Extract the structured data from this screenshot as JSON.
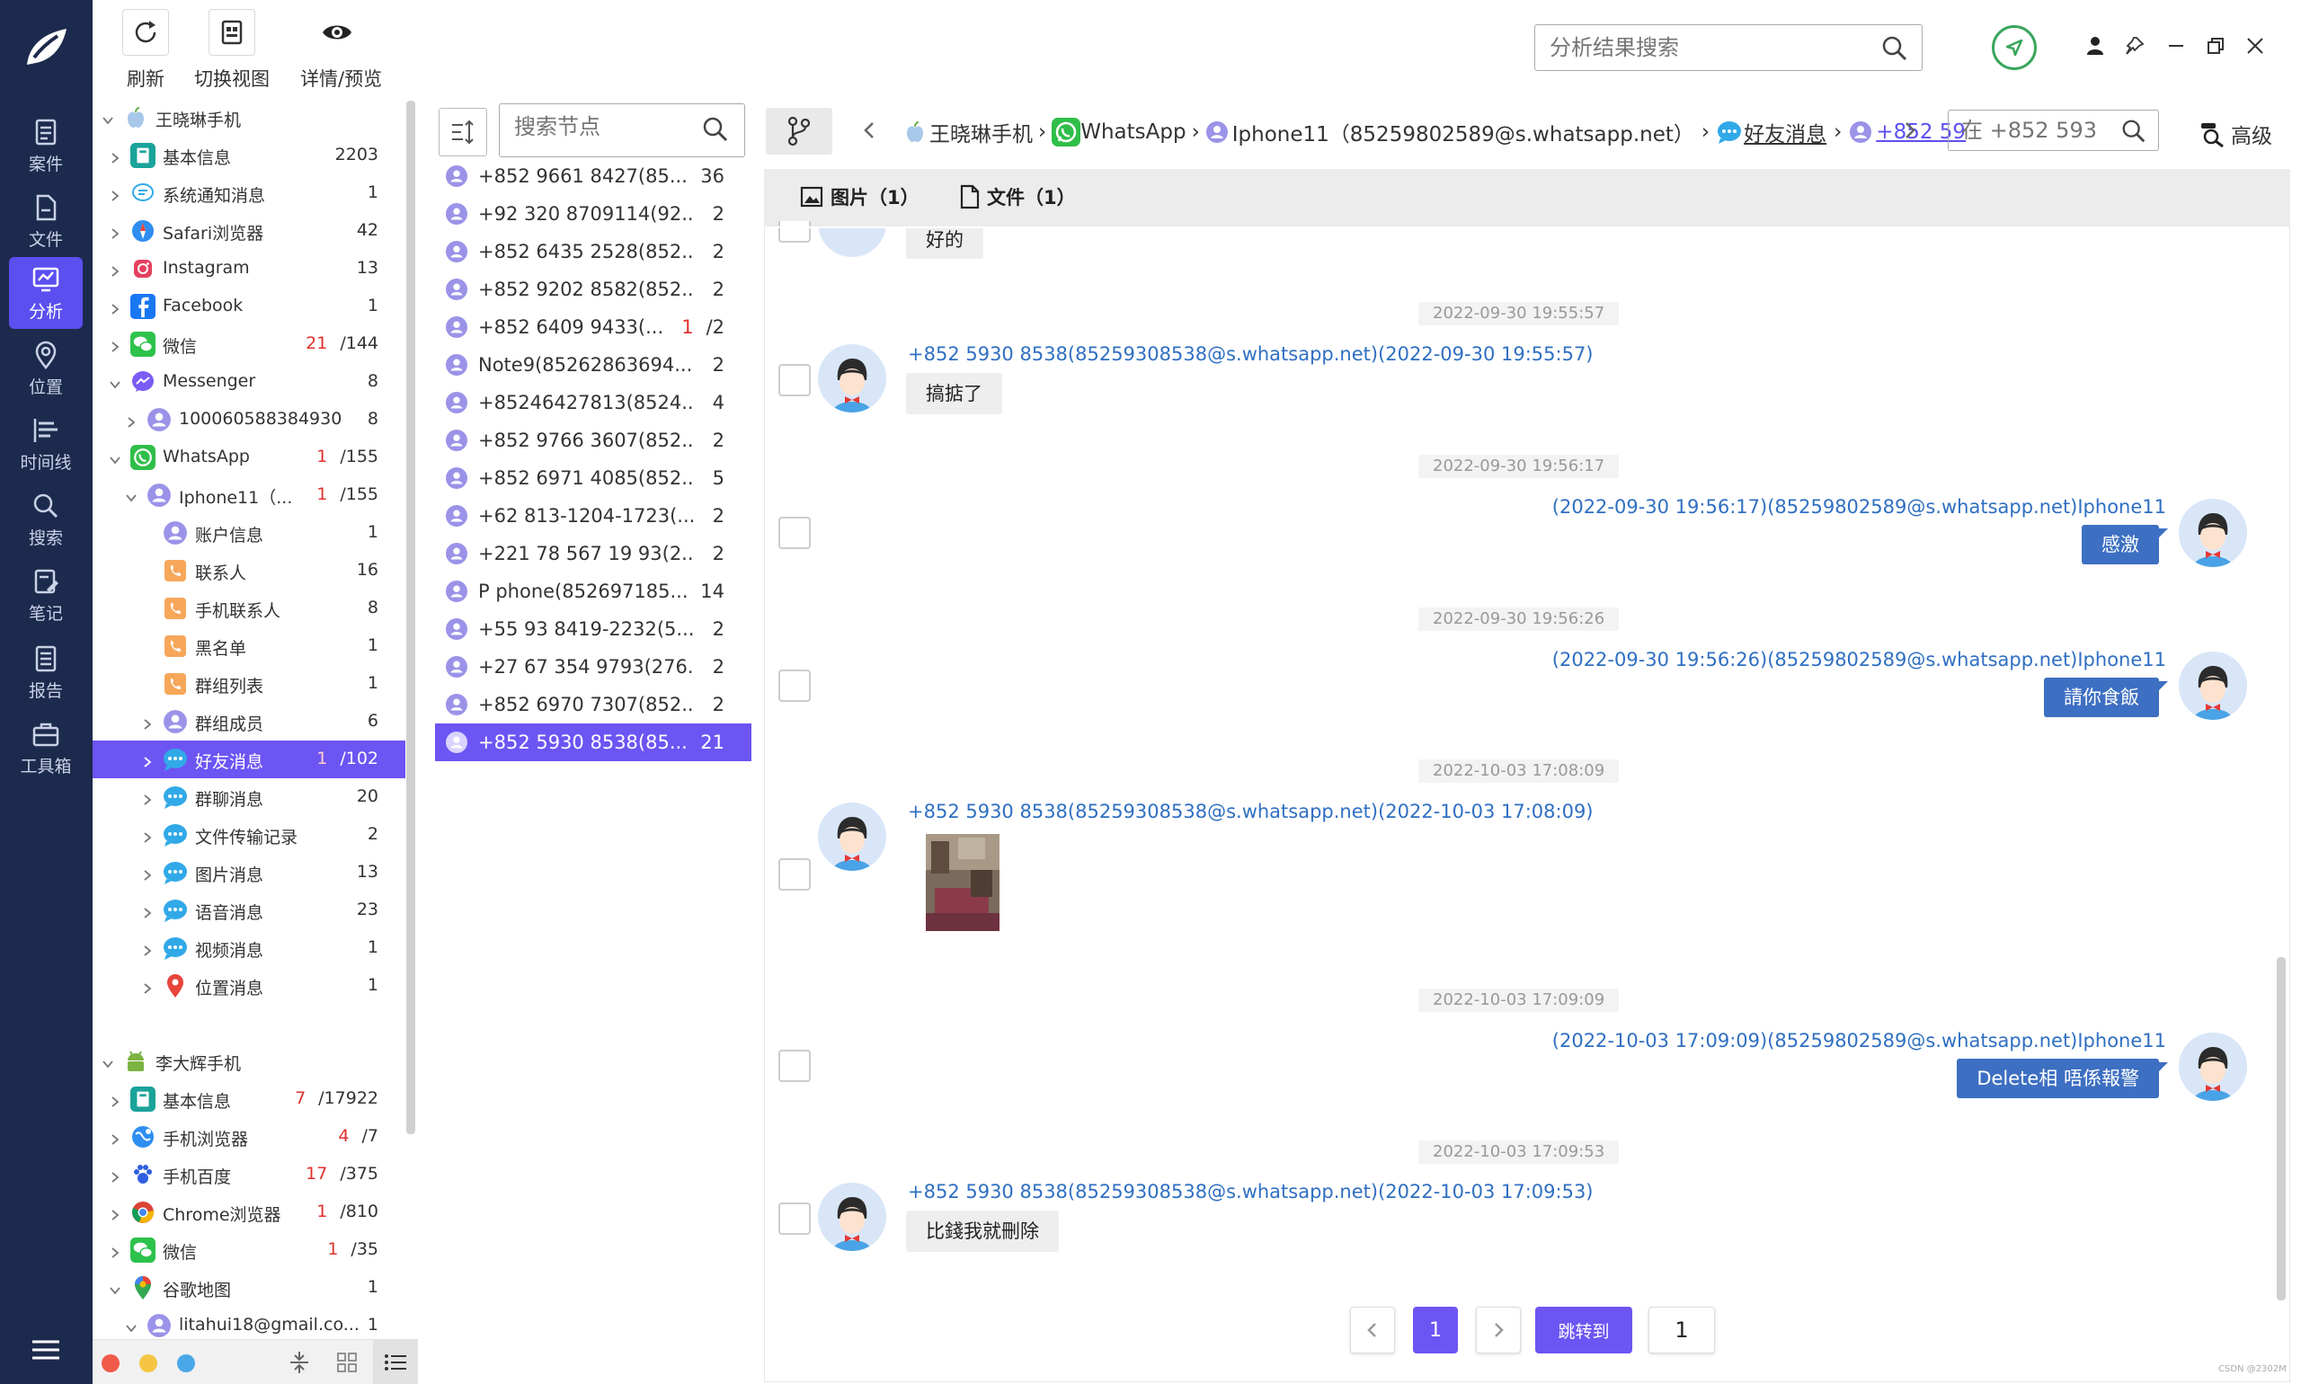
{
  "toolbar": {
    "refresh": "刷新",
    "switch_view": "切换视图",
    "detail_preview": "详情/预览",
    "search_placeholder": "分析结果搜索"
  },
  "nav": {
    "items": [
      {
        "label": "案件"
      },
      {
        "label": "文件"
      },
      {
        "label": "分析"
      },
      {
        "label": "位置"
      },
      {
        "label": "时间线"
      },
      {
        "label": "搜索"
      },
      {
        "label": "笔记"
      },
      {
        "label": "报告"
      },
      {
        "label": "工具箱"
      }
    ]
  },
  "tree": {
    "rows": [
      {
        "label": "王晓琳手机",
        "count": "",
        "red": ""
      },
      {
        "label": "基本信息",
        "count": "2203",
        "red": ""
      },
      {
        "label": "系统通知消息",
        "count": "1",
        "red": ""
      },
      {
        "label": "Safari浏览器",
        "count": "42",
        "red": ""
      },
      {
        "label": "Instagram",
        "count": "13",
        "red": ""
      },
      {
        "label": "Facebook",
        "count": "1",
        "red": ""
      },
      {
        "label": "微信",
        "count": "/144",
        "red": "21"
      },
      {
        "label": "Messenger",
        "count": "8",
        "red": ""
      },
      {
        "label": "100060588384930",
        "count": "8",
        "red": ""
      },
      {
        "label": "WhatsApp",
        "count": "/155",
        "red": "1"
      },
      {
        "label": "Iphone11（...",
        "count": "/155",
        "red": "1"
      },
      {
        "label": "账户信息",
        "count": "1",
        "red": ""
      },
      {
        "label": "联系人",
        "count": "16",
        "red": ""
      },
      {
        "label": "手机联系人",
        "count": "8",
        "red": ""
      },
      {
        "label": "黑名单",
        "count": "1",
        "red": ""
      },
      {
        "label": "群组列表",
        "count": "1",
        "red": ""
      },
      {
        "label": "群组成员",
        "count": "6",
        "red": ""
      },
      {
        "label": "好友消息",
        "count": "/102",
        "red": "1"
      },
      {
        "label": "群聊消息",
        "count": "20",
        "red": ""
      },
      {
        "label": "文件传输记录",
        "count": "2",
        "red": ""
      },
      {
        "label": "图片消息",
        "count": "13",
        "red": ""
      },
      {
        "label": "语音消息",
        "count": "23",
        "red": ""
      },
      {
        "label": "视频消息",
        "count": "1",
        "red": ""
      },
      {
        "label": "位置消息",
        "count": "1",
        "red": ""
      },
      {
        "label": "李大辉手机",
        "count": "",
        "red": ""
      },
      {
        "label": "基本信息",
        "count": "/17922",
        "red": "7"
      },
      {
        "label": "手机浏览器",
        "count": "/7",
        "red": "4"
      },
      {
        "label": "手机百度",
        "count": "/375",
        "red": "17"
      },
      {
        "label": "Chrome浏览器",
        "count": "/810",
        "red": "1"
      },
      {
        "label": "微信",
        "count": "/35",
        "red": "1"
      },
      {
        "label": "谷歌地图",
        "count": "1",
        "red": ""
      },
      {
        "label": "litahui18@gmail.co...",
        "count": "1",
        "red": ""
      }
    ]
  },
  "contacts": {
    "search_placeholder": "搜索节点",
    "items": [
      {
        "name": "+852 9661 8427(85...",
        "count": "36",
        "red": ""
      },
      {
        "name": "+92 320 8709114(92...",
        "count": "2",
        "red": ""
      },
      {
        "name": "+852 6435 2528(852...",
        "count": "2",
        "red": ""
      },
      {
        "name": "+852 9202 8582(852...",
        "count": "2",
        "red": ""
      },
      {
        "name": "+852 6409 9433(...",
        "count": "/2",
        "red": "1"
      },
      {
        "name": "Note9(85262863694...",
        "count": "2",
        "red": ""
      },
      {
        "name": "+85246427813(8524...",
        "count": "4",
        "red": ""
      },
      {
        "name": "+852 9766 3607(852...",
        "count": "2",
        "red": ""
      },
      {
        "name": "+852 6971 4085(852...",
        "count": "5",
        "red": ""
      },
      {
        "name": "+62 813-1204-1723(...",
        "count": "2",
        "red": ""
      },
      {
        "name": "+221 78 567 19 93(2...",
        "count": "2",
        "red": ""
      },
      {
        "name": "P phone(852697185...",
        "count": "14",
        "red": ""
      },
      {
        "name": "+55 93 8419-2232(5...",
        "count": "2",
        "red": ""
      },
      {
        "name": "+27 67 354 9793(276...",
        "count": "2",
        "red": ""
      },
      {
        "name": "+852 6970 7307(852...",
        "count": "2",
        "red": ""
      },
      {
        "name": "+852 5930 8538(85...",
        "count": "21",
        "red": ""
      }
    ]
  },
  "breadcrumb": {
    "device": "王晓琳手机",
    "app": "WhatsApp",
    "account": "Iphone11（85259802589@s.whatsapp.net）",
    "category": "好友消息",
    "contact": "+852 59",
    "search_placeholder": "在 +852 593",
    "advanced": "高级"
  },
  "tabs": {
    "images": "图片（1）",
    "files": "文件（1）"
  },
  "messages": {
    "partial_text": "好的",
    "items": [
      {
        "time": "2022-09-30 19:55:57",
        "side": "left",
        "sender": "+852 5930 8538(85259308538@s.whatsapp.net)(2022-09-30 19:55:57)",
        "text": "搞掂了"
      },
      {
        "time": "2022-09-30 19:56:17",
        "side": "right",
        "sender": "(2022-09-30 19:56:17)(85259802589@s.whatsapp.net)Iphone11",
        "text": "感激"
      },
      {
        "time": "2022-09-30 19:56:26",
        "side": "right",
        "sender": "(2022-09-30 19:56:26)(85259802589@s.whatsapp.net)Iphone11",
        "text": "請你食飯"
      },
      {
        "time": "2022-10-03 17:08:09",
        "side": "left",
        "sender": "+852 5930 8538(85259308538@s.whatsapp.net)(2022-10-03 17:08:09)",
        "text": ""
      },
      {
        "time": "2022-10-03 17:09:09",
        "side": "right",
        "sender": "(2022-10-03 17:09:09)(85259802589@s.whatsapp.net)Iphone11",
        "text": "Delete相 唔係報警"
      },
      {
        "time": "2022-10-03 17:09:53",
        "side": "left",
        "sender": "+852 5930 8538(85259308538@s.whatsapp.net)(2022-10-03 17:09:53)",
        "text": "比錢我就刪除"
      }
    ]
  },
  "pagination": {
    "current": "1",
    "jump_label": "跳转到",
    "jump_value": "1"
  },
  "colors": {
    "accent": "#6c55f3",
    "nav_bg": "#1c2a4d",
    "bubble_out": "#3d6fc2",
    "link": "#2f6fc2",
    "red_count": "#e0312c"
  },
  "watermark": "CSDN @2302M"
}
